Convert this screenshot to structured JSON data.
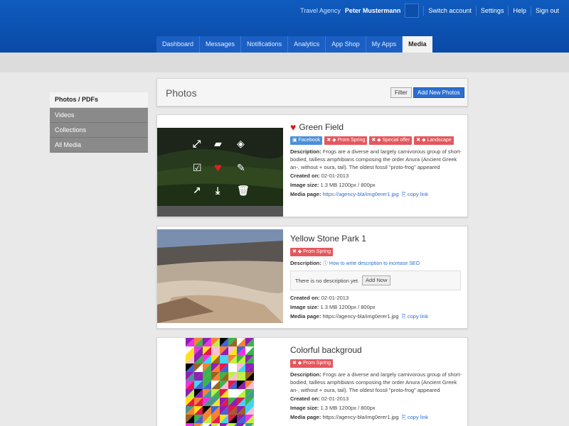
{
  "header": {
    "agency": "Travel Agency",
    "username": "Peter Mustermann",
    "links": [
      "Switch account",
      "Settings",
      "Help",
      "Sign out"
    ],
    "tabs": [
      "Dashboard",
      "Messages",
      "Notifications",
      "Analytics",
      "App Shop",
      "My Apps",
      "Media"
    ],
    "active_tab": "Media"
  },
  "sidebar": {
    "items": [
      {
        "label": "Photos / PDFs"
      },
      {
        "label": "Videos"
      },
      {
        "label": "Collections"
      },
      {
        "label": "All Media"
      }
    ]
  },
  "panel": {
    "title": "Photos",
    "filter_label": "Filter",
    "add_label": "Add New Photos"
  },
  "cards": [
    {
      "title": "Green Field",
      "tags": [
        {
          "label": "Facebook",
          "color": "blue"
        },
        {
          "label": "Prom Spring",
          "color": "red"
        },
        {
          "label": "Special offer",
          "color": "red"
        },
        {
          "label": "Landscape",
          "color": "red"
        }
      ],
      "description_label": "Description:",
      "description": "Frogs are a diverse and largely carnivorous group of short-bodied, tailless amphibians composing the order Anura (Ancient Greek an-, without + oura, tail). The oldest fossil \"proto-frog\" appeared",
      "created_label": "Created on:",
      "created": "02-01-2013",
      "size_label": "Image size:",
      "size": "1.3 MB 1200px / 800px",
      "page_label": "Media page:",
      "page": "https://agency-bla/img0erer1.jpg",
      "copy_label": "copy link"
    },
    {
      "title": "Yellow Stone Park 1",
      "tags": [
        {
          "label": "Prom Spring",
          "color": "red"
        }
      ],
      "description_label": "Description:",
      "description_hint": "How to write description to increase SEO",
      "no_description": "There is no description yet.",
      "add_now_label": "Add Now",
      "created_label": "Created on:",
      "created": "02-01-2013",
      "size_label": "Image size:",
      "size": "1.3 MB 1200px / 800px",
      "page_label": "Media page:",
      "page": "https://agency-bla/img0erer1.jpg",
      "copy_label": "copy link"
    },
    {
      "title": "Colorful backgroud",
      "tags": [
        {
          "label": "Prom Spring",
          "color": "red"
        }
      ],
      "description_label": "Description:",
      "description": "Frogs are a diverse and largely carnivorous group of short-bodied, tailless amphibians composing the order Anura (Ancient Greek an-, without + oura, tail). The oldest fossil \"proto-frog\" appeared",
      "created_label": "Created on:",
      "created": "02-01-2013",
      "size_label": "Image size:",
      "size": "1.3 MB 1200px / 800px",
      "page_label": "Media page:",
      "page": "https://agency-bla/img0erer1.jpg",
      "copy_label": "copy link"
    }
  ]
}
